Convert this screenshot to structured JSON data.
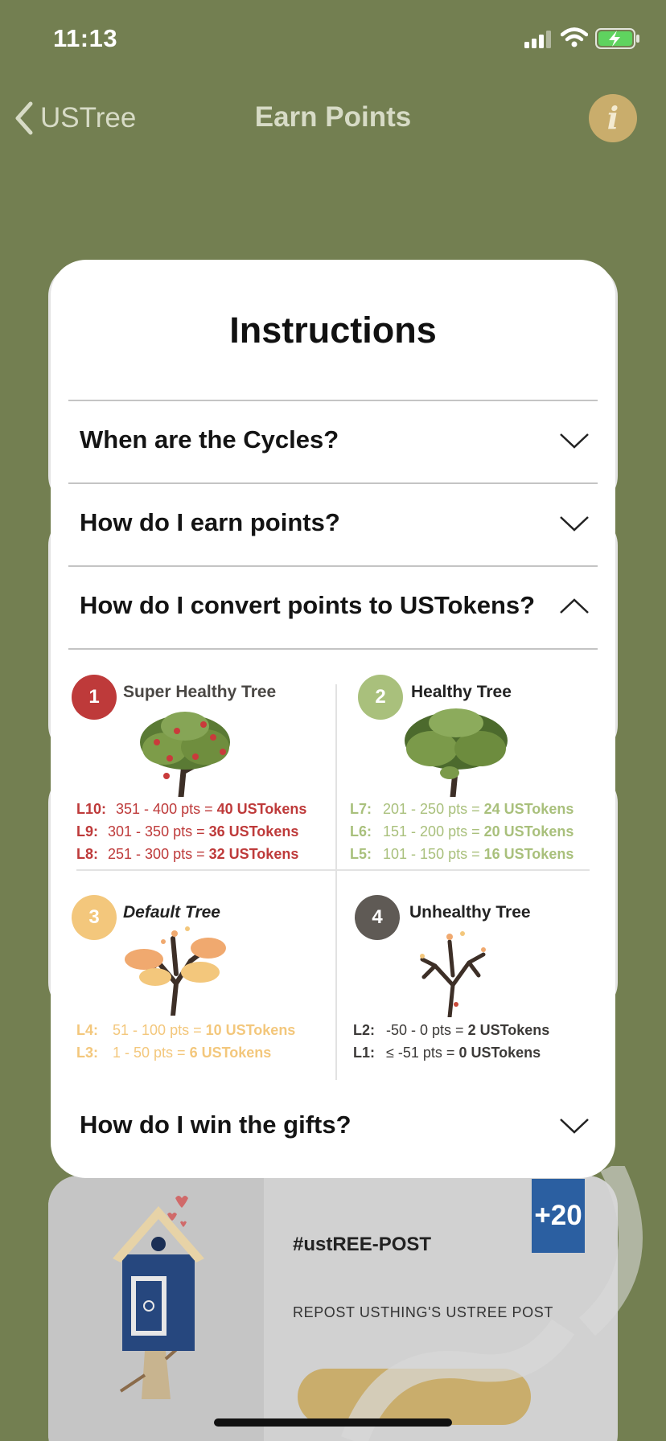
{
  "status": {
    "time": "11:13"
  },
  "nav": {
    "back_label": "USTree",
    "title": "Earn Points",
    "info_glyph": "i"
  },
  "modal": {
    "title": "Instructions",
    "questions": [
      {
        "label": "When are the Cycles?",
        "state": "collapsed"
      },
      {
        "label": "How do I earn points?",
        "state": "collapsed"
      },
      {
        "label": "How do I convert points to USTokens?",
        "state": "expanded"
      },
      {
        "label": "How do I win the gifts?",
        "state": "collapsed"
      }
    ],
    "trees": [
      {
        "num": "1",
        "name": "Super Healthy Tree",
        "color": "#be3a3a",
        "levels": [
          {
            "level": "L10:",
            "range": "351 - 400 pts =",
            "tokens": "40 USTokens"
          },
          {
            "level": "L9:",
            "range": "301 - 350 pts =",
            "tokens": "36 USTokens"
          },
          {
            "level": "L8:",
            "range": "251 - 300 pts =",
            "tokens": "32 USTokens"
          }
        ]
      },
      {
        "num": "2",
        "name": "Healthy Tree",
        "color": "#a9c07c",
        "levels": [
          {
            "level": "L7:",
            "range": "201 - 250 pts =",
            "tokens": "24 USTokens"
          },
          {
            "level": "L6:",
            "range": "151 - 200 pts =",
            "tokens": "20 USTokens"
          },
          {
            "level": "L5:",
            "range": "101 - 150 pts =",
            "tokens": "16 USTokens"
          }
        ]
      },
      {
        "num": "3",
        "name": "Default Tree",
        "color": "#f3c77c",
        "levels": [
          {
            "level": "L4:",
            "range": "51 - 100 pts =",
            "tokens": "10 USTokens"
          },
          {
            "level": "L3:",
            "range": "1 - 50 pts =",
            "tokens": "6 USTokens"
          }
        ]
      },
      {
        "num": "4",
        "name": "Unhealthy Tree",
        "color": "#5f5a55",
        "levels": [
          {
            "level": "L2:",
            "range": "-50 - 0 pts  =",
            "tokens": "2 USTokens"
          },
          {
            "level": "L1:",
            "range": "≤ -51 pts =",
            "tokens": "0 USTokens"
          }
        ]
      }
    ]
  },
  "activity": {
    "badge": "+20",
    "title": "#ustREE-POST",
    "description": "REPOST USTHING'S USTREE POST"
  }
}
